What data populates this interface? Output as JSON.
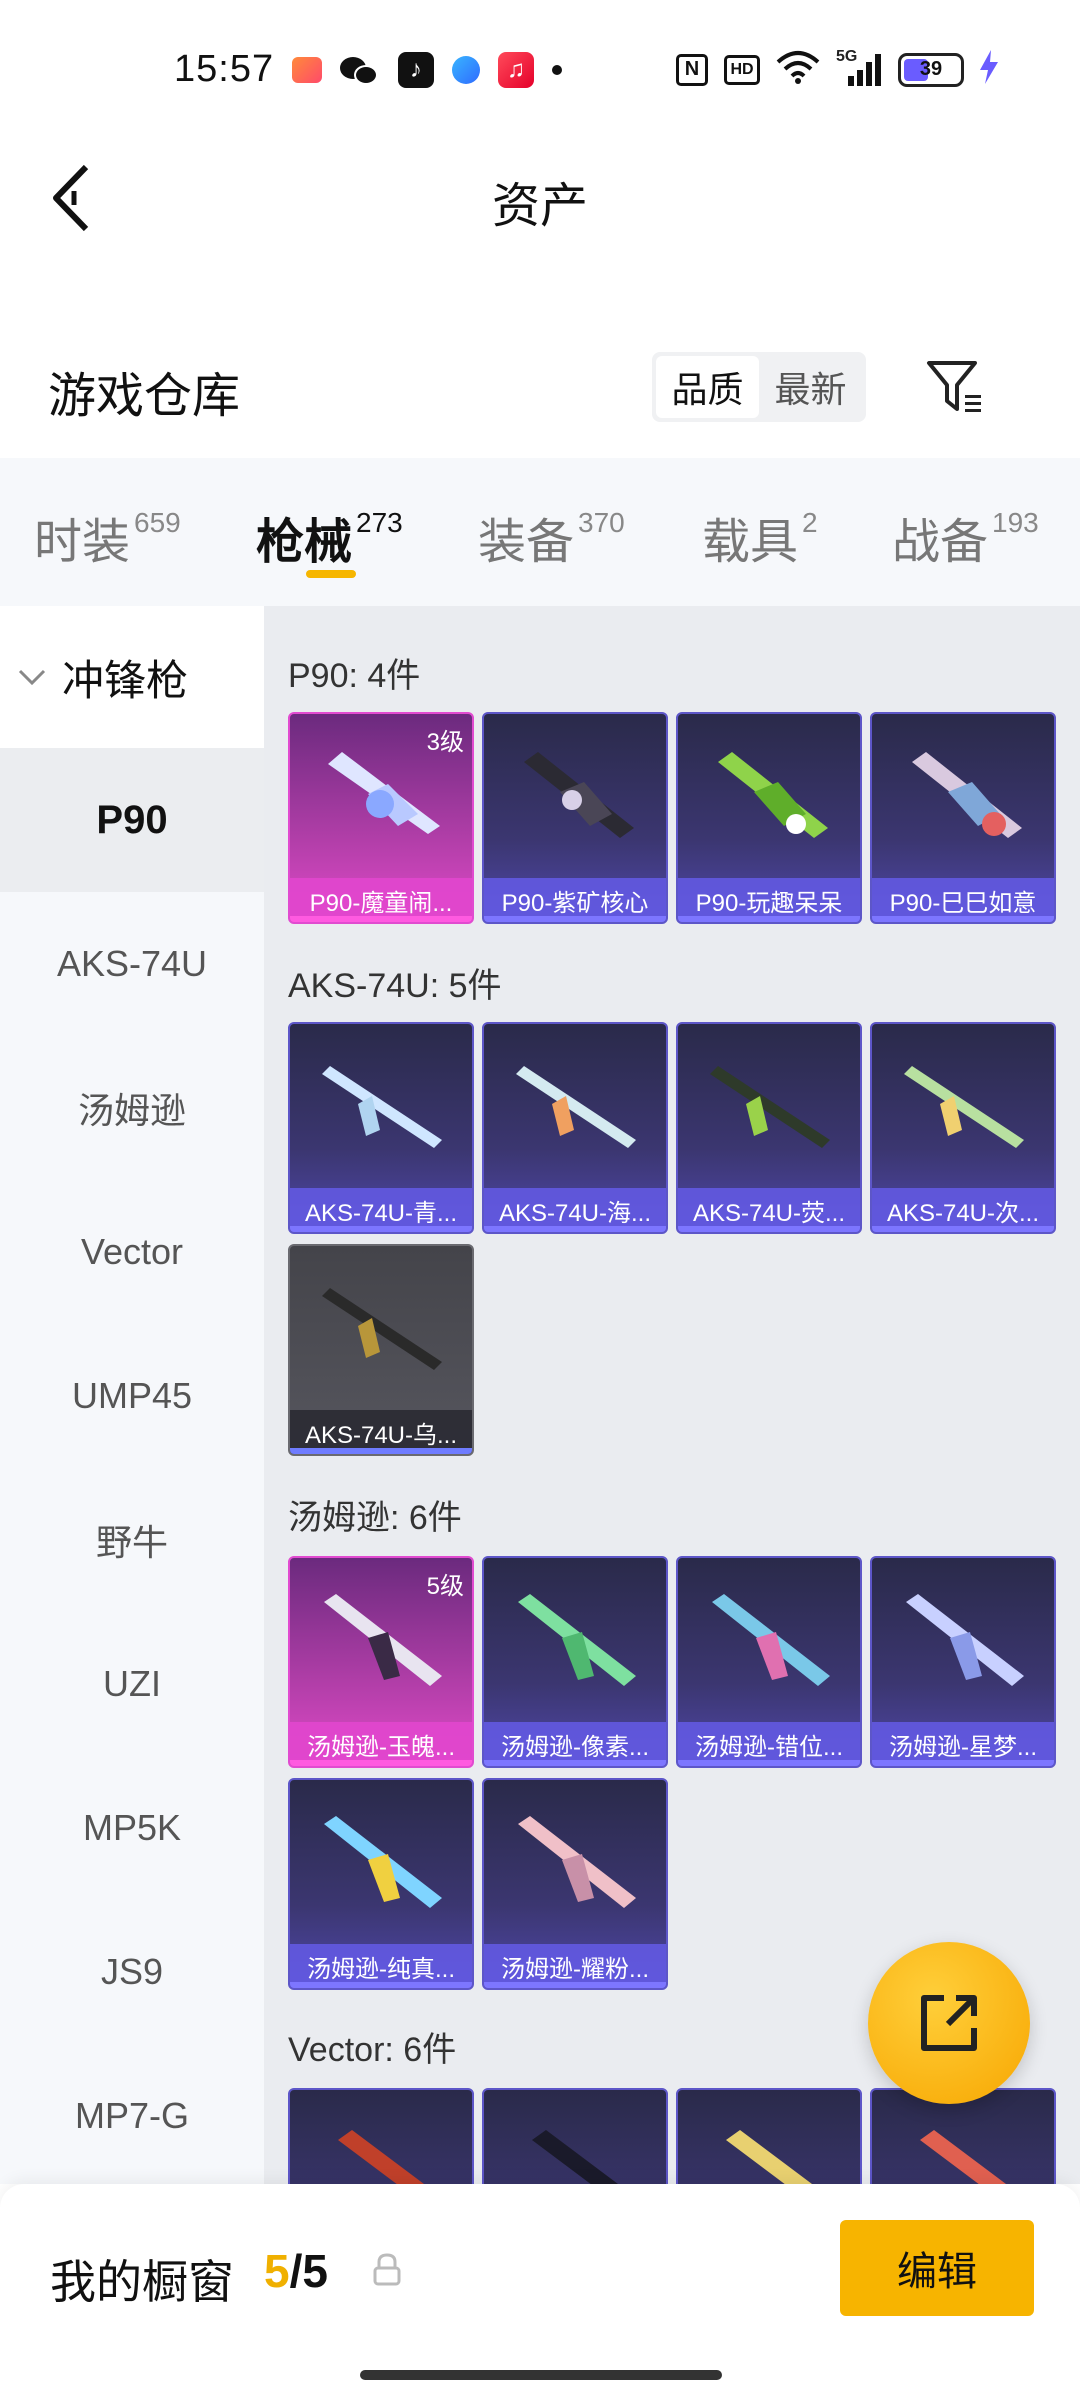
{
  "status": {
    "time": "15:57",
    "battery": "39",
    "network": "5G",
    "hd": "HD",
    "nfc": "N"
  },
  "header": {
    "title": "资产"
  },
  "section": {
    "title": "游戏仓库",
    "sort_options": [
      "品质",
      "最新"
    ]
  },
  "tabs": [
    {
      "label": "时装",
      "count": "659"
    },
    {
      "label": "枪械",
      "count": "273"
    },
    {
      "label": "装备",
      "count": "370"
    },
    {
      "label": "载具",
      "count": "2"
    },
    {
      "label": "战备",
      "count": "193"
    }
  ],
  "sidebar": {
    "group": "冲锋枪",
    "items": [
      "P90",
      "AKS-74U",
      "汤姆逊",
      "Vector",
      "UMP45",
      "野牛",
      "UZI",
      "MP5K",
      "JS9",
      "MP7-G"
    ]
  },
  "groups": [
    {
      "label": "P90: 4件",
      "cards": [
        {
          "name": "P90-魔童闹...",
          "level": "3级"
        },
        {
          "name": "P90-紫矿核心"
        },
        {
          "name": "P90-玩趣呆呆"
        },
        {
          "name": "P90-巳巳如意"
        }
      ]
    },
    {
      "label": "AKS-74U: 5件",
      "cards": [
        {
          "name": "AKS-74U-青..."
        },
        {
          "name": "AKS-74U-海..."
        },
        {
          "name": "AKS-74U-荧..."
        },
        {
          "name": "AKS-74U-次..."
        },
        {
          "name": "AKS-74U-乌..."
        }
      ]
    },
    {
      "label": "汤姆逊: 6件",
      "cards": [
        {
          "name": "汤姆逊-玉魄...",
          "level": "5级"
        },
        {
          "name": "汤姆逊-像素..."
        },
        {
          "name": "汤姆逊-错位..."
        },
        {
          "name": "汤姆逊-星梦..."
        },
        {
          "name": "汤姆逊-纯真..."
        },
        {
          "name": "汤姆逊-耀粉..."
        }
      ]
    },
    {
      "label": "Vector: 6件",
      "cards": []
    }
  ],
  "bottom": {
    "showcase_label": "我的橱窗",
    "showcase_current": "5",
    "showcase_sep": "/",
    "showcase_total": "5",
    "edit_label": "编辑"
  },
  "colors": {
    "accent": "#f7b400",
    "card_purple": "#4f47a8",
    "card_pink": "#e04ac8",
    "card_grey": "#56565e"
  }
}
